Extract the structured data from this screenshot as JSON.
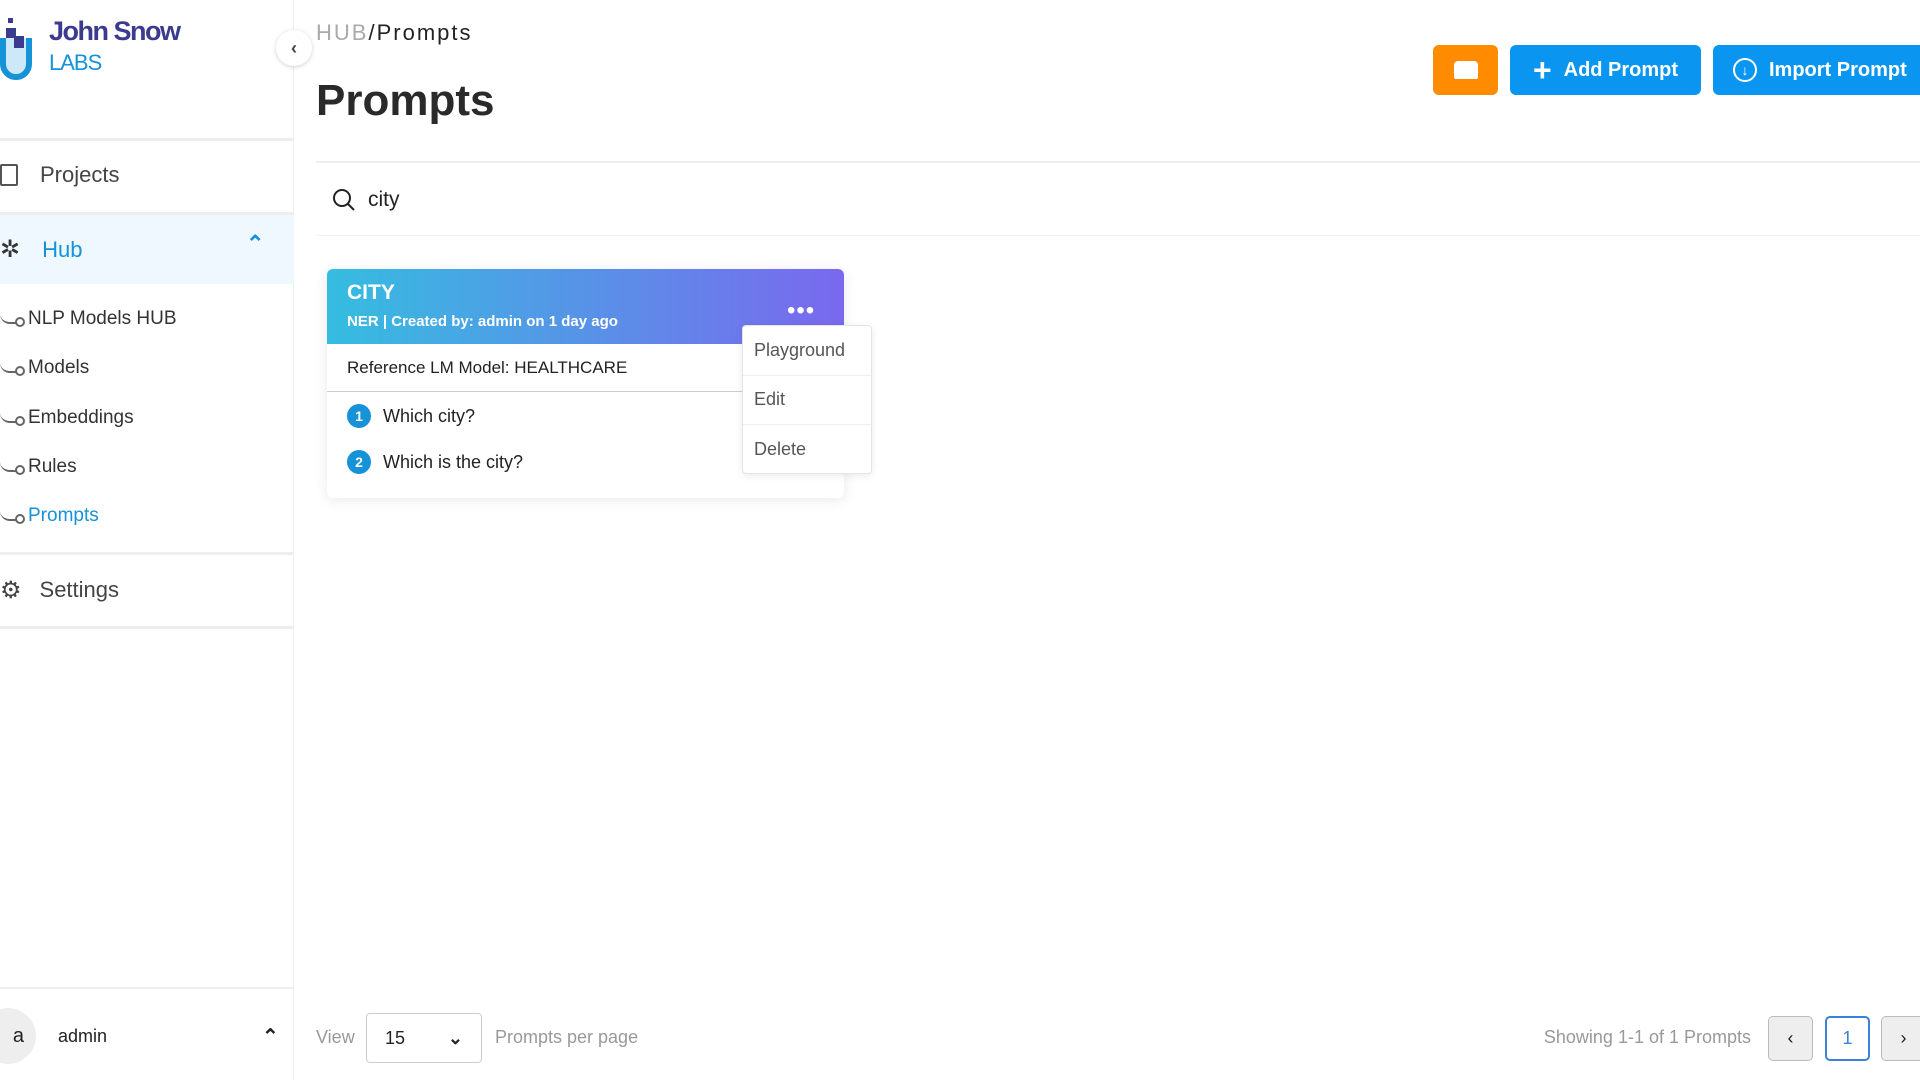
{
  "logo": {
    "line1": "John Snow",
    "line2": "LABS"
  },
  "sidebar": {
    "projects": "Projects",
    "hub": "Hub",
    "sub_items": [
      "NLP Models HUB",
      "Models",
      "Embeddings",
      "Rules",
      "Prompts"
    ],
    "settings": "Settings",
    "user": {
      "avatar": "a",
      "name": "admin"
    }
  },
  "breadcrumb": {
    "root": "HUB",
    "sep": "/",
    "current": "Prompts"
  },
  "page_title": "Prompts",
  "toolbar": {
    "add": "Add Prompt",
    "import": "Import Prompt"
  },
  "search": {
    "value": "city"
  },
  "card": {
    "title": "CITY",
    "meta": "NER | Created by: admin on 1 day ago",
    "reference": "Reference LM Model: HEALTHCARE",
    "questions": [
      {
        "n": "1",
        "text": "Which city?"
      },
      {
        "n": "2",
        "text": "Which is the city?"
      }
    ]
  },
  "menu": [
    "Playground",
    "Edit",
    "Delete"
  ],
  "footer": {
    "view": "View",
    "per_page": "15",
    "per_page_label": "Prompts per page",
    "showing": "Showing 1-1 of 1 Prompts",
    "page": "1"
  },
  "colors": {
    "accent": "#1592d8",
    "orange": "#ff8c00",
    "button": "#0a96f0"
  }
}
